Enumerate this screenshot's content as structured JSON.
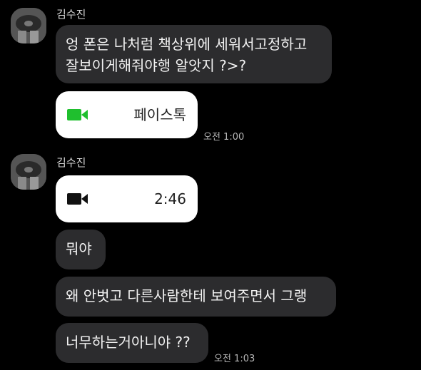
{
  "chat": {
    "group1": {
      "sender": "김수진",
      "msg1_line1": "엉 폰은 나처럼 책상위에 세워서고정하고",
      "msg1_line2": "잘보이게해줘야행 알앗지 ?>?",
      "call_label": "페이스톡",
      "call_icon": "video-camera-icon",
      "call_icon_color": "#1FBF2E",
      "time": "오전 1:00"
    },
    "group2": {
      "sender": "김수진",
      "call_duration": "2:46",
      "call_icon": "video-camera-icon",
      "call_icon_color": "#111111",
      "msg2": "뭐야",
      "msg3": "왜  안벗고 다른사람한테 보여주면서 그랭",
      "msg4": "너무하는거아니야 ??",
      "time": "오전 1:03"
    }
  },
  "colors": {
    "background": "#000000",
    "bubble_dark": "#2c2c2e",
    "bubble_light": "#ffffff"
  }
}
